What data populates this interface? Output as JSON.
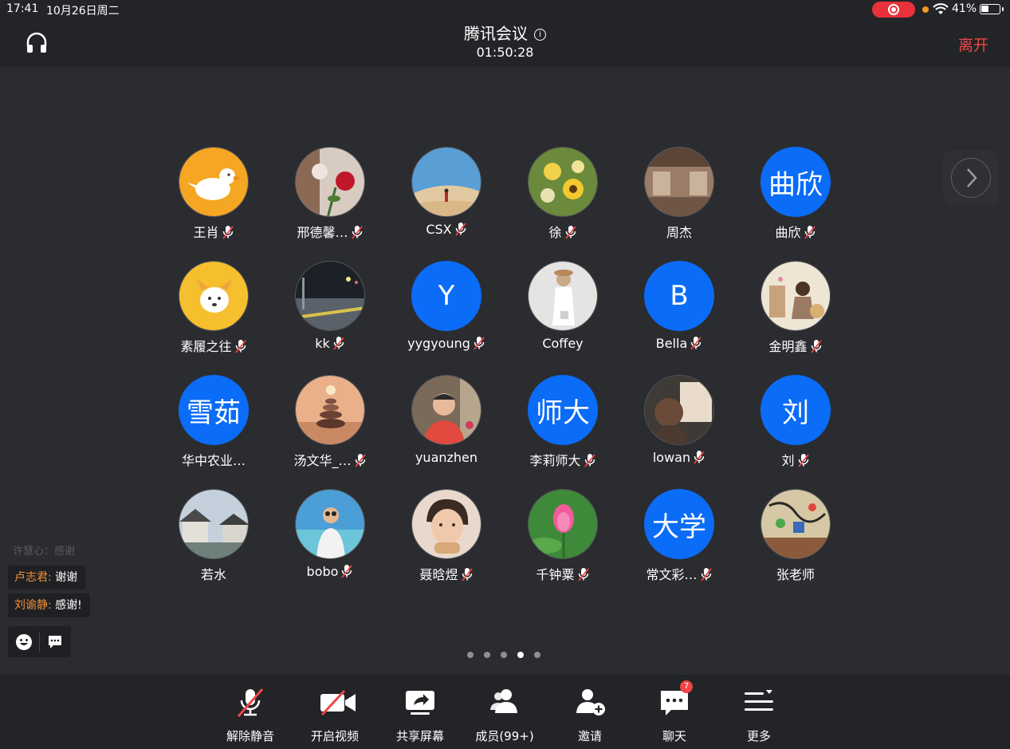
{
  "status": {
    "time": "17:41",
    "date": "10月26日周二",
    "battery": "41%"
  },
  "header": {
    "title": "腾讯会议",
    "info_glyph": "i",
    "timer": "01:50:28",
    "leave": "离开"
  },
  "participants": [
    {
      "name": "王肖",
      "muted": true,
      "avatar": "duck-photo"
    },
    {
      "name": "邢德馨…",
      "muted": true,
      "avatar": "rose-photo"
    },
    {
      "name": "CSX",
      "muted": true,
      "avatar": "desert-photo"
    },
    {
      "name": "徐",
      "muted": true,
      "avatar": "flowers-photo"
    },
    {
      "name": "周杰",
      "muted": false,
      "avatar": "room-photo"
    },
    {
      "name": "曲欣",
      "muted": true,
      "abbr": "曲欣"
    },
    {
      "name": "素履之往",
      "muted": true,
      "avatar": "dog-photo"
    },
    {
      "name": "kk",
      "muted": true,
      "avatar": "station-photo"
    },
    {
      "name": "yygyoung",
      "muted": true,
      "abbr": "Y"
    },
    {
      "name": "Coffey",
      "muted": false,
      "avatar": "girl-photo"
    },
    {
      "name": "Bella",
      "muted": true,
      "abbr": "B"
    },
    {
      "name": "金明鑫",
      "muted": true,
      "avatar": "painting-photo"
    },
    {
      "name": "华中农业…",
      "muted": false,
      "abbr": "雪茹"
    },
    {
      "name": "汤文华_…",
      "muted": true,
      "avatar": "stones-photo"
    },
    {
      "name": "yuanzhen",
      "muted": false,
      "avatar": "man-photo"
    },
    {
      "name": "李莉师大",
      "muted": true,
      "abbr": "师大"
    },
    {
      "name": "lowan",
      "muted": true,
      "avatar": "window-photo"
    },
    {
      "name": "刘",
      "muted": true,
      "abbr": "刘"
    },
    {
      "name": "若水",
      "muted": false,
      "avatar": "town-photo"
    },
    {
      "name": "bobo",
      "muted": true,
      "avatar": "beach-photo"
    },
    {
      "name": "聂晗煜",
      "muted": true,
      "avatar": "child-photo"
    },
    {
      "name": "千钟粟",
      "muted": true,
      "avatar": "lotus-photo"
    },
    {
      "name": "常文彩…",
      "muted": true,
      "abbr": "大学"
    },
    {
      "name": "张老师",
      "muted": false,
      "avatar": "mural-photo"
    }
  ],
  "chat": {
    "ghost": "许慧心：感谢",
    "messages": [
      {
        "sender": "卢志君:",
        "text": "谢谢"
      },
      {
        "sender": "刘谕静:",
        "text": "感谢!"
      }
    ]
  },
  "pager": {
    "pages": 5,
    "current": 4
  },
  "toolbar": {
    "unmute": "解除静音",
    "video": "开启视频",
    "share": "共享屏幕",
    "members": "成员(99+)",
    "invite": "邀请",
    "chat": "聊天",
    "chat_badge": "7",
    "more": "更多"
  },
  "colors": {
    "background": "#2b2c30",
    "bar": "#232427",
    "accent_blue": "#0a6cf7",
    "leave_red": "#f04545",
    "sender_orange": "#f0923a"
  }
}
